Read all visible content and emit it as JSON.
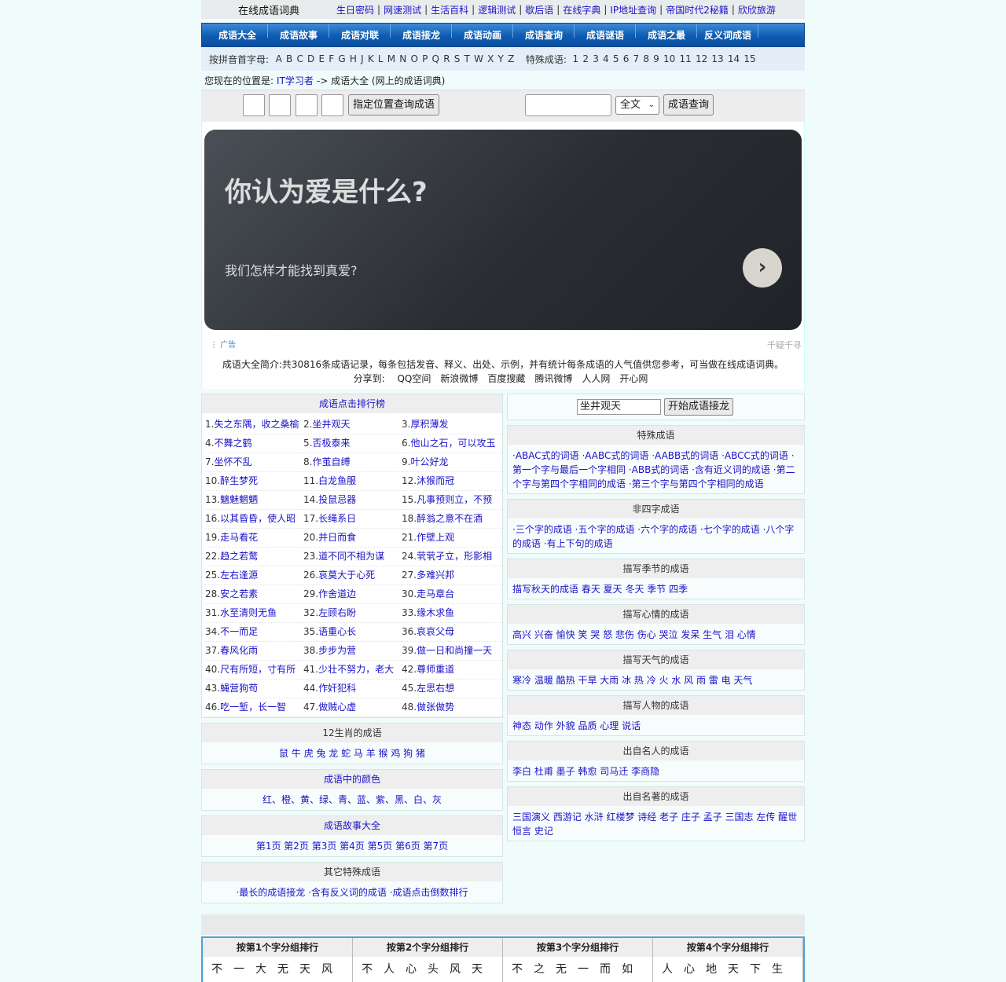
{
  "top": {
    "site": "在线成语词典",
    "links": [
      "生日密码",
      "网速测试",
      "生活百科",
      "逻辑测试",
      "歇后语",
      "在线字典",
      "IP地址查询",
      "帝国时代2秘籍",
      "欣欣旅游"
    ]
  },
  "nav": [
    "成语大全",
    "成语故事",
    "成语对联",
    "成语接龙",
    "成语动画",
    "成语查询",
    "成语谜语",
    "成语之最",
    "反义词成语"
  ],
  "pinyin": {
    "label": "按拼音首字母:",
    "letters": [
      "A",
      "B",
      "C",
      "D",
      "E",
      "F",
      "G",
      "H",
      "J",
      "K",
      "L",
      "M",
      "N",
      "O",
      "P",
      "Q",
      "R",
      "S",
      "T",
      "W",
      "X",
      "Y",
      "Z"
    ],
    "special_label": "特殊成语:",
    "numbers": [
      "1",
      "2",
      "3",
      "4",
      "5",
      "6",
      "7",
      "8",
      "9",
      "10",
      "11",
      "12",
      "13",
      "14",
      "15"
    ]
  },
  "location": {
    "prefix": "您现在的位置是:",
    "link": "IT学习者",
    "rest": "-> 成语大全 (网上的成语词典)"
  },
  "search": {
    "pos_button": "指定位置查询成语",
    "select": "全文",
    "query_button": "成语查询"
  },
  "ad": {
    "headline": "你认为爱是什么?",
    "sub": "我们怎样才能找到真爱?",
    "tag": "广告",
    "source": "千疑千寻"
  },
  "intro": {
    "text": "成语大全简介:共30816条成语记录，每条包括发音、释义、出处、示例，并有统计每条成语的人气值供您参考，可当做在线成语词典。",
    "share_label": "分享到:",
    "share": [
      "QQ空间",
      "新浪微博",
      "百度搜藏",
      "腾讯微博",
      "人人网",
      "开心网"
    ]
  },
  "ranking": {
    "title": "成语点击排行榜",
    "items": [
      "失之东隅，收之桑榆",
      "坐井观天",
      "厚积薄发",
      "不舞之鹤",
      "否极泰来",
      "他山之石，可以攻玉",
      "坐怀不乱",
      "作茧自缚",
      "叶公好龙",
      "醉生梦死",
      "白龙鱼服",
      "沐猴而冠",
      "魑魅魍魉",
      "投鼠忌器",
      "凡事预则立，不预",
      "以其昏昏，使人昭",
      "长绳系日",
      "醉翁之意不在酒",
      "走马看花",
      "并日而食",
      "作壁上观",
      "趋之若鹜",
      "道不同不相为谋",
      "茕茕孑立，形影相",
      "左右逢源",
      "哀莫大于心死",
      "多难兴邦",
      "安之若素",
      "作舍道边",
      "走马章台",
      "水至清则无鱼",
      "左顾右盼",
      "缘木求鱼",
      "不一而足",
      "语重心长",
      "哀哀父母",
      "春风化雨",
      "步步为营",
      "做一日和尚撞一天",
      "尺有所短，寸有所",
      "少壮不努力，老大",
      "尊师重道",
      "蝇营狗苟",
      "作奸犯科",
      "左思右想",
      "吃一堑，长一智",
      "做贼心虚",
      "做张做势"
    ]
  },
  "zodiac": {
    "title": "12生肖的成语",
    "items": "鼠 牛 虎 兔 龙 蛇 马 羊 猴 鸡 狗 猪"
  },
  "colors": {
    "title": "成语中的颜色",
    "items": "红、橙、黄、绿、青、蓝、紫、黑、白、灰"
  },
  "stories": {
    "title": "成语故事大全",
    "items": "第1页 第2页 第3页 第4页 第5页 第6页 第7页"
  },
  "others": {
    "title": "其它特殊成语",
    "items": "·最长的成语接龙 ·含有反义词的成语 ·成语点击倒数排行"
  },
  "jielong": {
    "value": "坐井观天",
    "button": "开始成语接龙"
  },
  "right_panels": [
    {
      "title": "特殊成语",
      "text": "·ABAC式的词语 ·AABC式的词语 ·AABB式的词语 ·ABCC式的词语 ·第一个字与最后一个字相同 ·ABB式的词语 ·含有近义词的成语 ·第二个字与第四个字相同的成语 ·第三个字与第四个字相同的成语"
    },
    {
      "title": "非四字成语",
      "text": "·三个字的成语 ·五个字的成语 ·六个字的成语 ·七个字的成语 ·八个字的成语 ·有上下句的成语"
    },
    {
      "title": "描写季节的成语",
      "text": "描写秋天的成语 春天 夏天 冬天 季节 四季"
    },
    {
      "title": "描写心情的成语",
      "text": "高兴 兴奋 愉快 笑 哭 怒 悲伤 伤心 哭泣 发呆 生气 泪 心情"
    },
    {
      "title": "描写天气的成语",
      "text": "寒冷 温暖 酷热 干旱 大雨 冰 热 冷 火 水 风 雨 雷 电 天气"
    },
    {
      "title": "描写人物的成语",
      "text": "神态 动作 外貌 品质 心理 说话"
    },
    {
      "title": "出自名人的成语",
      "text": "李白 杜甫 墨子 韩愈 司马迁 李商隐"
    },
    {
      "title": "出自名著的成语",
      "text": "三国演义 西游记 水浒 红楼梦 诗经 老子 庄子 孟子 三国志 左传 醒世恒言 史记"
    }
  ],
  "groups": {
    "headers": [
      "按第1个字分组排行",
      "按第2个字分组排行",
      "按第3个字分组排行",
      "按第4个字分组排行"
    ],
    "chars": [
      "不一大无天风",
      "不人心头风天",
      "不之无一而如",
      "人心地天下生"
    ]
  }
}
